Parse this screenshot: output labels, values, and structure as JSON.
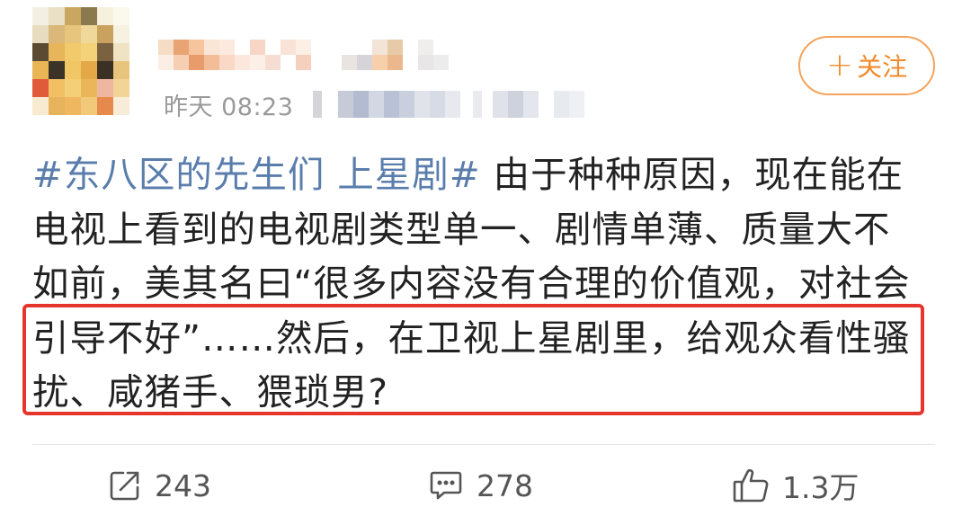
{
  "header": {
    "time": "昨天 08:23",
    "follow_label": "关注",
    "follow_plus": "+"
  },
  "post": {
    "lines": [
      {
        "hashtag": "#东八区的先生们 上星剧#",
        "text": " 由于种种原因，现在能在"
      },
      {
        "text": "电视上看到的电视剧类型单一、剧情单薄、质量大不"
      },
      {
        "text": "如前，美其名曰“很多内容没有合理的价值观，对社会"
      },
      {
        "text": "引导不好”……然后，在卫视上星剧里，给观众看性骚"
      },
      {
        "text": "扰、咸猪手、猥琐男?"
      }
    ]
  },
  "actions": {
    "repost": {
      "icon": "share-icon",
      "count": "243"
    },
    "comment": {
      "icon": "comment-icon",
      "count": "278"
    },
    "like": {
      "icon": "thumbs-up-icon",
      "count": "1.3万"
    }
  },
  "colors": {
    "hashtag": "#5a7dac",
    "follow": "#f08a2b",
    "highlight": "#e6352a"
  }
}
